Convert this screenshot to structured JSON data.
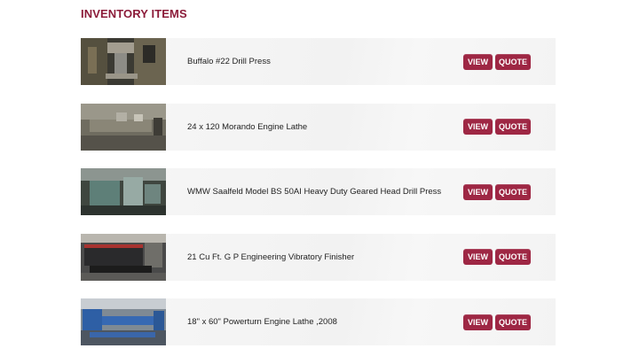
{
  "page": {
    "title": "INVENTORY ITEMS"
  },
  "buttons": {
    "view_label": "VIEW",
    "quote_label": "QUOTE"
  },
  "items": [
    {
      "name": "Buffalo #22 Drill Press"
    },
    {
      "name": "24 x 120 Morando Engine Lathe"
    },
    {
      "name": "WMW Saalfeld Model BS 50AI Heavy Duty Geared Head Drill Press"
    },
    {
      "name": "21 Cu Ft. G P Engineering Vibratory Finisher"
    },
    {
      "name": "18\" x 60\" Powerturn Engine Lathe ,2008"
    }
  ],
  "colors": {
    "accent": "#9e2744",
    "title": "#8c1c3a"
  }
}
